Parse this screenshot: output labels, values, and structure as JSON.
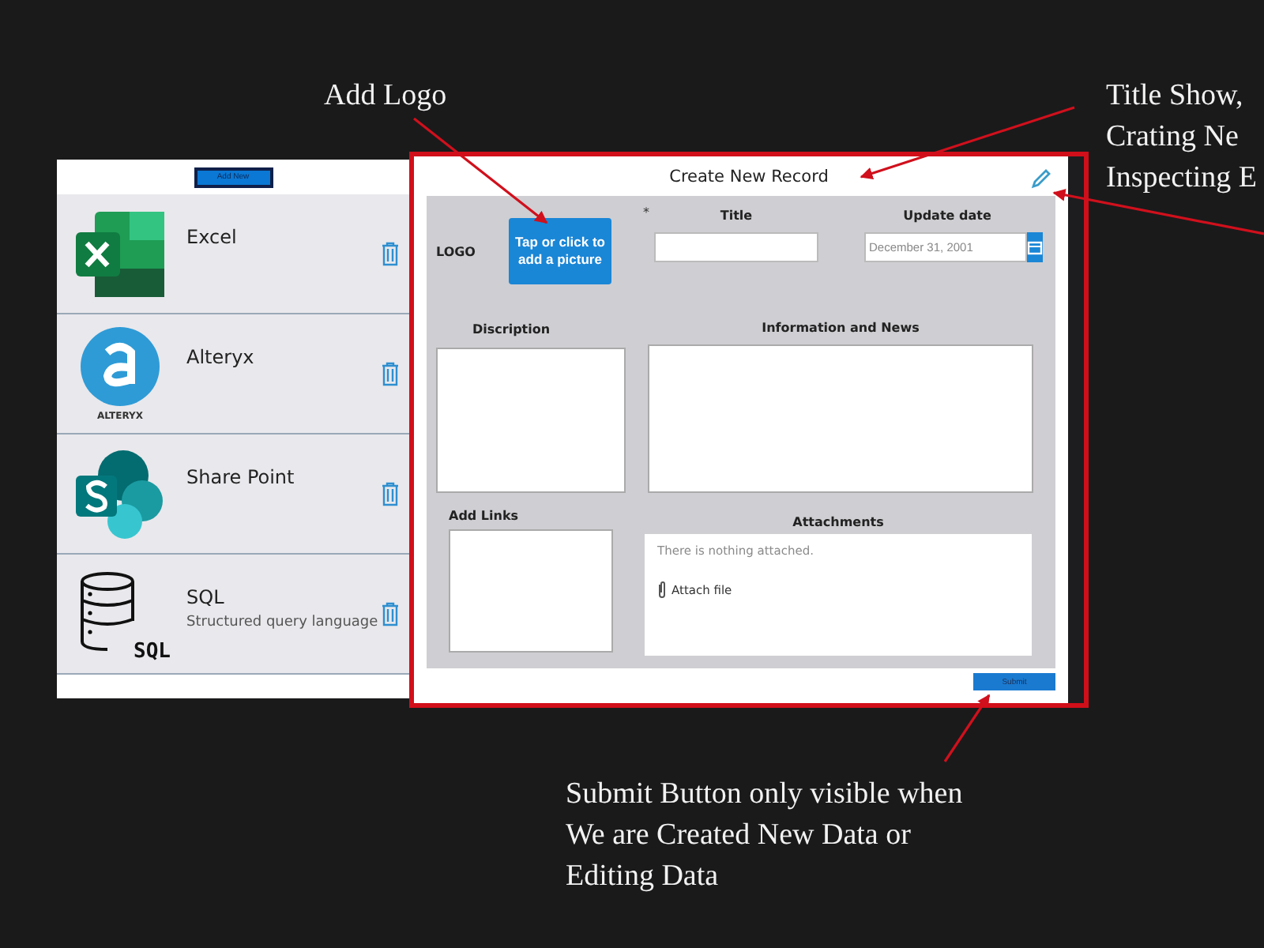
{
  "annotations": [
    {
      "kind": "logo",
      "lines": [
        "Add Logo"
      ]
    },
    {
      "kind": "title",
      "lines": [
        "Title Show,",
        "Crating Ne",
        "Inspecting E"
      ]
    },
    {
      "kind": "submit",
      "lines": [
        "Submit Button only visible when",
        "We are Created New Data or",
        "Editing Data"
      ]
    }
  ],
  "list": {
    "add_button": "Add New",
    "items": [
      {
        "kind": "excel",
        "title": "Excel"
      },
      {
        "kind": "alteryx",
        "title": "Alteryx",
        "logo_caption": "ALTERYX"
      },
      {
        "kind": "sharepoint",
        "title": "Share Point"
      },
      {
        "kind": "sql",
        "title": "SQL",
        "subtitle": "Structured query language",
        "logo_caption": "SQL"
      }
    ]
  },
  "form": {
    "title": "Create New Record",
    "logo_label": "LOGO",
    "logo_button": "Tap or click to add a picture",
    "required_mark": "*",
    "title_label": "Title",
    "date_label": "Update date",
    "date_placeholder": "December 31, 2001",
    "description_label": "Discription",
    "info_label": "Information and News",
    "links_label": "Add Links",
    "attachments_label": "Attachments",
    "attachments_empty": "There is nothing attached.",
    "attach_link": "Attach file",
    "submit": "Submit"
  }
}
